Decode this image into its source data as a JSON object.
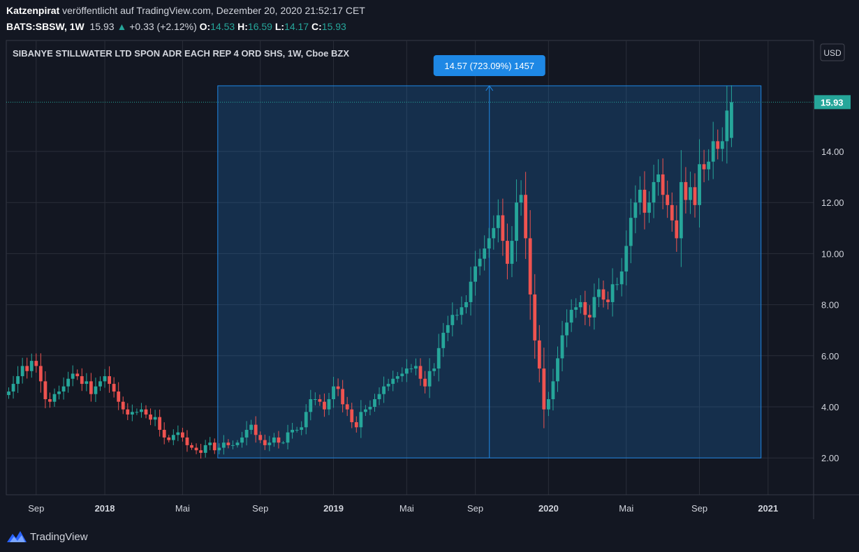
{
  "header": {
    "author": "Katzenpirat",
    "published_text": " veröffentlicht auf TradingView.com, Dezember 20, 2020 21:52:17 CET",
    "symbol": "BATS:SBSW, 1W",
    "last": "15.93",
    "change_arrow": "▲",
    "change": "+0.33 (+2.12%)",
    "open_label": "O:",
    "open": "14.53",
    "high_label": "H:",
    "high": "16.59",
    "low_label": "L:",
    "low": "14.17",
    "close_label": "C:",
    "close": "15.93"
  },
  "footer": {
    "brand": "TradingView"
  },
  "colors": {
    "bg": "#131722",
    "up": "#26a69a",
    "down": "#ef5350",
    "grid": "#2a2e39",
    "accent": "#2962ff",
    "measure": "#1e88e5"
  },
  "chart_data": {
    "type": "candlestick",
    "title": "SIBANYE STILLWATER LTD SPON ADR EACH REP 4 ORD SHS, 1W, Cboe BZX",
    "currency_label": "USD",
    "last_price_label": "15.93",
    "y_ticks": [
      "2.00",
      "4.00",
      "6.00",
      "8.00",
      "10.00",
      "12.00",
      "14.00"
    ],
    "ylim": [
      0.6,
      17.6
    ],
    "x_ticks": [
      {
        "label": "Sep",
        "bar": 6,
        "bold": false
      },
      {
        "label": "2018",
        "bar": 21,
        "bold": true
      },
      {
        "label": "Mai",
        "bar": 38,
        "bold": false
      },
      {
        "label": "Sep",
        "bar": 55,
        "bold": false
      },
      {
        "label": "2019",
        "bar": 71,
        "bold": true
      },
      {
        "label": "Mai",
        "bar": 87,
        "bold": false
      },
      {
        "label": "Sep",
        "bar": 102,
        "bold": false
      },
      {
        "label": "2020",
        "bar": 118,
        "bold": true
      },
      {
        "label": "Mai",
        "bar": 135,
        "bold": false
      },
      {
        "label": "Sep",
        "bar": 151,
        "bold": false
      },
      {
        "label": "2021",
        "bar": 166,
        "bold": true
      }
    ],
    "measure": {
      "label": "14.57 (723.09%) 1457",
      "start_bar": 46,
      "end_bar": 164,
      "low": 2.0,
      "high": 16.57
    },
    "close": [
      4.6,
      4.9,
      5.2,
      5.6,
      5.4,
      5.8,
      5.6,
      5.0,
      4.3,
      4.2,
      4.5,
      4.6,
      4.8,
      5.1,
      5.3,
      5.2,
      4.9,
      5.0,
      4.5,
      4.8,
      5.0,
      5.2,
      4.9,
      4.6,
      4.2,
      3.9,
      3.7,
      3.8,
      3.8,
      3.9,
      3.7,
      3.5,
      3.6,
      3.1,
      2.8,
      2.7,
      2.9,
      3.0,
      2.8,
      2.5,
      2.4,
      2.3,
      2.2,
      2.5,
      2.6,
      2.3,
      2.4,
      2.6,
      2.5,
      2.5,
      2.6,
      2.8,
      3.1,
      3.3,
      2.9,
      2.7,
      2.5,
      2.6,
      2.8,
      2.6,
      2.6,
      3.0,
      3.1,
      3.1,
      3.2,
      3.8,
      4.3,
      4.3,
      4.2,
      3.9,
      4.3,
      4.8,
      4.7,
      4.1,
      3.9,
      3.4,
      3.2,
      3.8,
      3.9,
      4.0,
      4.3,
      4.5,
      4.8,
      4.9,
      5.1,
      5.2,
      5.3,
      5.5,
      5.5,
      5.6,
      5.1,
      4.8,
      5.4,
      5.5,
      6.3,
      6.9,
      7.2,
      7.6,
      7.6,
      7.9,
      8.1,
      8.9,
      9.5,
      9.8,
      10.2,
      10.6,
      11.0,
      11.5,
      10.5,
      9.6,
      10.5,
      12.0,
      12.3,
      10.6,
      8.4,
      6.6,
      5.5,
      3.9,
      4.3,
      5.0,
      5.9,
      6.8,
      7.3,
      7.8,
      7.9,
      8.1,
      7.6,
      7.5,
      8.3,
      8.6,
      8.2,
      8.1,
      8.8,
      8.8,
      9.3,
      10.3,
      11.4,
      12.0,
      12.5,
      11.6,
      12.0,
      12.8,
      13.1,
      12.3,
      11.9,
      11.3,
      10.6,
      12.8,
      12.1,
      12.6,
      11.9,
      13.5,
      13.3,
      13.6,
      14.4,
      14.1,
      14.4,
      15.6,
      15.93
    ]
  }
}
